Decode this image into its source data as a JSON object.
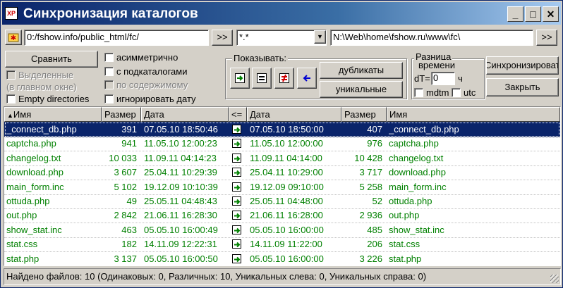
{
  "title": "Синхронизация каталогов",
  "title_icon_text": "XP",
  "titlebar_buttons": {
    "minimize": "_",
    "maximize": "□",
    "close": "✕"
  },
  "toolbar": {
    "left_path": "0:/fshow.info/public_html/fc/",
    "left_browse": ">>",
    "mask": "*.*",
    "right_path": "N:\\Web\\home\\fshow.ru\\www\\fc\\",
    "right_browse": ">>"
  },
  "options": {
    "compare_button": "Сравнить",
    "selected_only": "Выделенные",
    "in_main_window": "(в главном окне)",
    "empty_directories": "Empty directories",
    "asymmetric": "асимметрично",
    "with_subdirs": "с подкаталогами",
    "by_content": "по содержимому",
    "ignore_date": "игнорировать дату"
  },
  "show_group": {
    "label": "Показывать:",
    "duplicates": "дубликаты",
    "unique": "уникальные"
  },
  "time_diff": {
    "label1": "Разница",
    "label2": "времени",
    "dt_label": "dT=",
    "dt_value": "0",
    "unit": "ч",
    "mdtm": "mdtm",
    "utc": "utc"
  },
  "actions": {
    "sync": "Синхронизировать",
    "close": "Закрыть"
  },
  "list": {
    "headers": [
      "Имя",
      "Размер",
      "Дата",
      "<=",
      "Дата",
      "Размер",
      "Имя"
    ],
    "rows": [
      {
        "name_l": "_connect_db.php",
        "size_l": "391",
        "date_l": "07.05.10 18:50:46",
        "date_r": "07.05.10 18:50:00",
        "size_r": "407",
        "name_r": "_connect_db.php"
      },
      {
        "name_l": "captcha.php",
        "size_l": "941",
        "date_l": "11.05.10 12:00:23",
        "date_r": "11.05.10 12:00:00",
        "size_r": "976",
        "name_r": "captcha.php"
      },
      {
        "name_l": "changelog.txt",
        "size_l": "10 033",
        "date_l": "11.09.11 04:14:23",
        "date_r": "11.09.11 04:14:00",
        "size_r": "10 428",
        "name_r": "changelog.txt"
      },
      {
        "name_l": "download.php",
        "size_l": "3 607",
        "date_l": "25.04.11 10:29:39",
        "date_r": "25.04.11 10:29:00",
        "size_r": "3 717",
        "name_r": "download.php"
      },
      {
        "name_l": "main_form.inc",
        "size_l": "5 102",
        "date_l": "19.12.09 10:10:39",
        "date_r": "19.12.09 09:10:00",
        "size_r": "5 258",
        "name_r": "main_form.inc"
      },
      {
        "name_l": "ottuda.php",
        "size_l": "49",
        "date_l": "25.05.11 04:48:43",
        "date_r": "25.05.11 04:48:00",
        "size_r": "52",
        "name_r": "ottuda.php"
      },
      {
        "name_l": "out.php",
        "size_l": "2 842",
        "date_l": "21.06.11 16:28:30",
        "date_r": "21.06.11 16:28:00",
        "size_r": "2 936",
        "name_r": "out.php"
      },
      {
        "name_l": "show_stat.inc",
        "size_l": "463",
        "date_l": "05.05.10 16:00:49",
        "date_r": "05.05.10 16:00:00",
        "size_r": "485",
        "name_r": "show_stat.inc"
      },
      {
        "name_l": "stat.css",
        "size_l": "182",
        "date_l": "14.11.09 12:22:31",
        "date_r": "14.11.09 11:22:00",
        "size_r": "206",
        "name_r": "stat.css"
      },
      {
        "name_l": "stat.php",
        "size_l": "3 137",
        "date_l": "05.05.10 16:00:50",
        "date_r": "05.05.10 16:00:00",
        "size_r": "3 226",
        "name_r": "stat.php"
      }
    ]
  },
  "status": "Найдено файлов: 10  (Одинаковых: 0, Различных: 10, Уникальных слева: 0, Уникальных справа: 0)"
}
